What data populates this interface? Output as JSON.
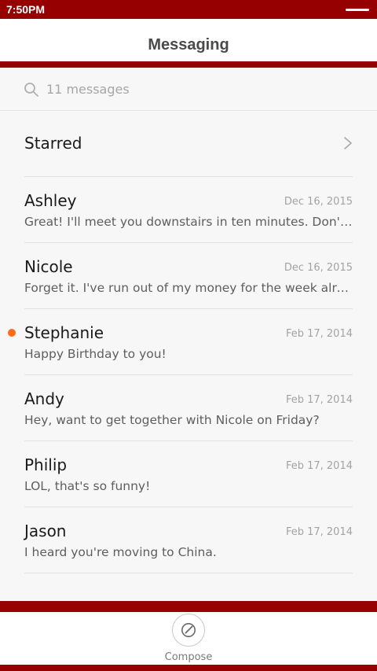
{
  "status_bar": {
    "time": "7:50PM"
  },
  "header": {
    "title": "Messaging"
  },
  "search": {
    "placeholder": "11 messages"
  },
  "starred": {
    "label": "Starred"
  },
  "threads": [
    {
      "name": "Ashley",
      "date": "Dec 16, 2015",
      "preview": "Great! I'll meet you downstairs in ten minutes. Don't forget your umbrella.",
      "unread": false
    },
    {
      "name": "Nicole",
      "date": "Dec 16, 2015",
      "preview": "Forget it. I've run out of my money for the week already.",
      "unread": false
    },
    {
      "name": "Stephanie",
      "date": "Feb 17, 2014",
      "preview": "Happy Birthday to you!",
      "unread": true
    },
    {
      "name": "Andy",
      "date": "Feb 17, 2014",
      "preview": "Hey, want to get together with Nicole on Friday?",
      "unread": false
    },
    {
      "name": "Philip",
      "date": "Feb 17, 2014",
      "preview": "LOL, that's so funny!",
      "unread": false
    },
    {
      "name": "Jason",
      "date": "Feb 17, 2014",
      "preview": "I heard you're moving to China.",
      "unread": false
    }
  ],
  "bottom_bar": {
    "compose_label": "Compose"
  },
  "colors": {
    "brand": "#960000",
    "unread_dot": "#ff6a1a",
    "background": "#f7f7f7"
  },
  "icons": {
    "search": "search-icon",
    "chevron": "chevron-right-icon",
    "compose": "compose-icon"
  }
}
